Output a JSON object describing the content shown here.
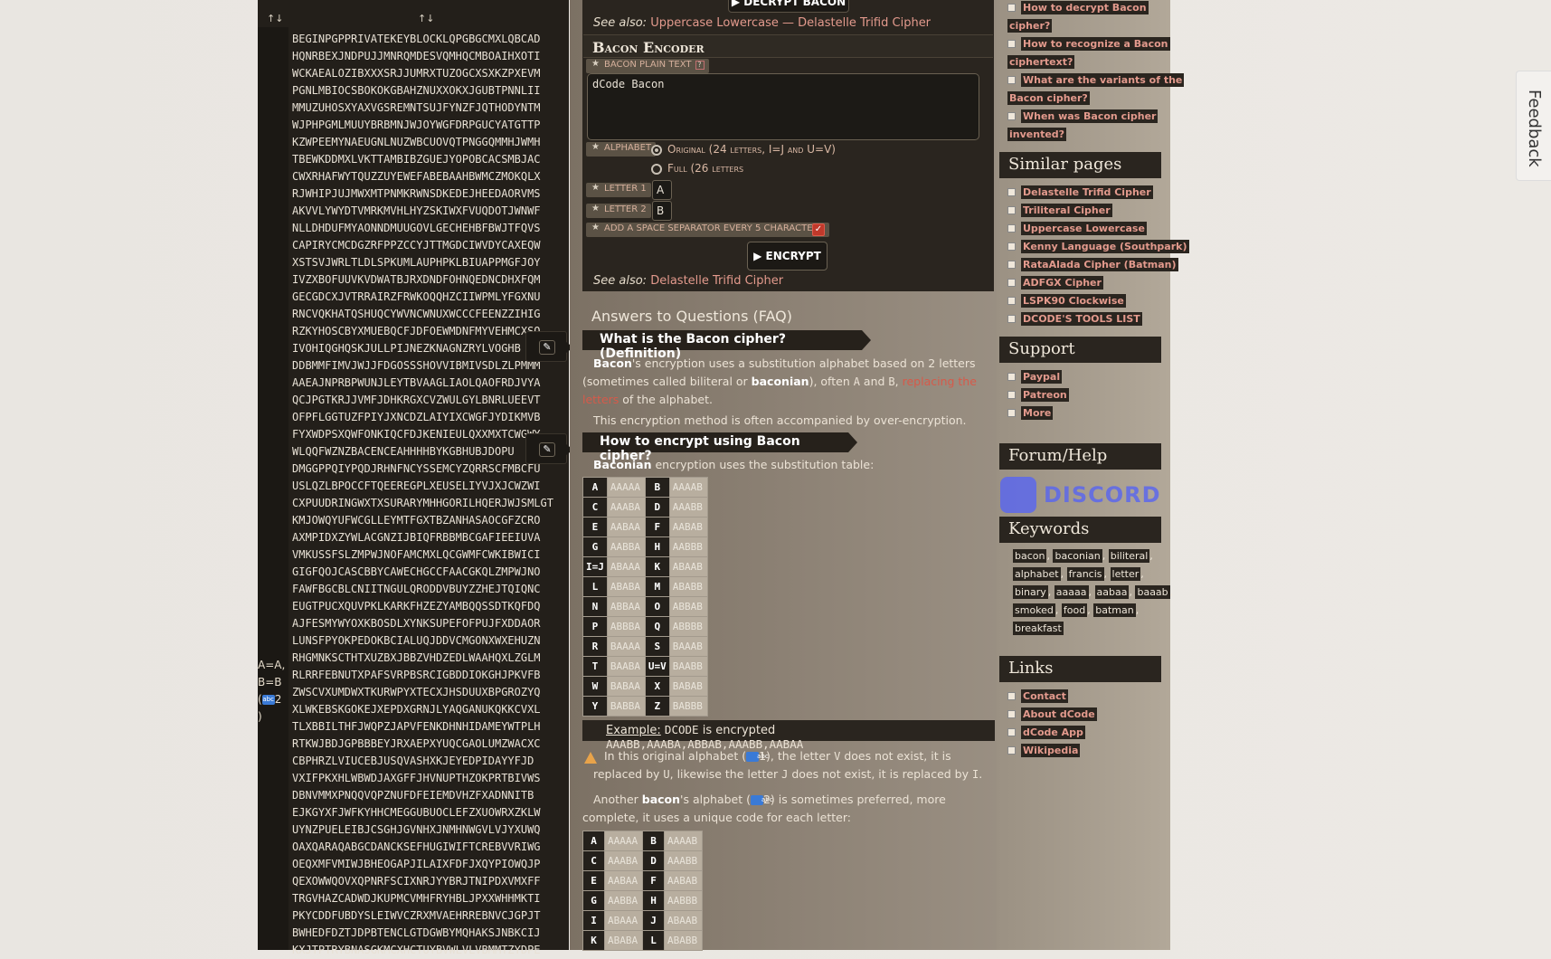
{
  "left_panel": {
    "sort_a": "↑↓",
    "sort_b": "↑↓",
    "note": [
      "A=A,",
      "B=B",
      "(",
      "2",
      ")"
    ],
    "lines": [
      "BEGINPGPPRIVATEKEYBLOCKLQPGBGCMXLQBCAD",
      "HQNRBEXJNDPUJJMNRQMDESVQMHQCMBOAIHXOTI",
      "WCKAEALOZIBXXXSRJJUMRXTUZOGCXSXKZPXEVM",
      "PGNLMBIOCSBOKOKGBAHZNUXXOKXJGUBTPNNLII",
      "MMUZUHOSXYAXVGSREMNTSUJFYNZFJQTHODYNTM",
      "WJPHPGMLMUUYBRBMNJWJOYWGFDRPGUCYATGTTP",
      "KZWPEEMYNAEUGNLNUZWBCUOVQTPNGGQMMHJWMH",
      "TBEWKDDMXLVKTTAMBIBZGUEJYOPOBCACSMBJAC",
      "CWXRHAFWYTQUZZUYEWEFABEBAAHBWMCZMOKQLX",
      "RJWHIPJUJMWXMTPNMKRWNSDKEDEJHEEDAORVMS",
      "AKVVLYWYDTVMRKMVHLHYZSKIWXFVUQDOTJWNWF",
      "NLLDHDUFMYAONNDMUUGOVLGECHEHBFBWJTFQVS",
      "CAPIRYCMCDGZRFPPZCCYJTTMGDCIWVDYCAXEQW",
      "XSTSVJWRLTLDLSPKUMLAUPHPKLBIUAPPMGFJOY",
      "IVZXBOFUUVKVDWATBJRXDNDFOHNQEDNCDHXFQM",
      "GECGDCXJVTRRAIRZFRWKOQQHZCIIWPMLYFGXNU",
      "RNCVQKHATQSHUQCYWVNCWNUXWCCCFEENZZIHIG",
      "RZKYHOSCBYXMUEBQCFJDFOEWMDNFMYVEHMCXSO",
      "IVOHIQGHQSKJULLPIJNEZKNAGNZRYLVOGHB",
      "DDBMMFIMVJWJJFDGOSSSHOVVIBMIVSDLZLPMMM",
      "AAEAJNPRBPWUNJLEYTBVAAGLIAOLQAOFRDJVYA",
      "QCJPGTKRJJVMFJDHKRGXCVZWULGYLBNRLUEEVT",
      "OFPFLGGTUZFPIYJXNCDZLAIYIXCWGFJYDIKMVB",
      "FYXWDPSXQWFONKIQCFDJKENIEULQXXMXTCWGWY",
      "WLQQFWZNZBACENCEAHHHHBYKGBHUBJDOPU",
      "DMGGPPQIYPQDJRHNFNCYSSEMCYZQRRSCFMBCFU",
      "USLQZLBPOCCFTQEEREGPLXEUSELIYVJXJCWZWI",
      "CXPUUDRINGWXTXSURARYMHHGORILHQERJWJSMLGT",
      "KMJOWQYUFWCGLLEYMTFGXTBZANHASAOCGFZCRO",
      "AXMPIDXZYWLACGNZIJBIQFRBBMBCGAFIEEIUVA",
      "VMKUSSFSLZMPWJNOFAMCMXLQCGWMFCWKIBWICI",
      "GIGFQOJCASCBBYCAWECHGCCFAACGKQLZMPWJNO",
      "FAWFBGCBLCNIITNGULQRODDVBUYZZHEJTQIQNC",
      "EUGTPUCXQUVPKLKARKFHZEZYAMBQQSSDTKQFDQ",
      "AJFESMYWYOXKBOSDLXYNKSUPEFOFPUJFXDDAOR",
      "LUNSFPYOKPEDOKBCIALUQJDDVCMGONXWXEHUZN",
      "RHGMNKSCTHTXUZBXJBBZVHDZEDLWAAHQXLZGLM",
      "RLRRFEBNUTXPAFSVRPBSRCIGBDDIOKGHJPKVFB",
      "ZWSCVXUMDWXTKURWPYXTECXJHSDUUXBPGROZYQ",
      "XLWKEBSKGOKEJXEPDXGRNJLYAQGANUKQKKCVXL",
      "TLXBBILTHFJWQPZJAPVFENKDHNHIDAMEYWTPLH",
      "RTKWJBDJGPBBBEYJRXAEPXYUQCGAOLUMZWACXC",
      "CBPHRZLVIUCEBJUSQVASHXKJEYEDPIDAYYFJD",
      "VXIFPKXHLWBWDJAXGFFJHVNUPTHZOKPRTBIVWS",
      "DBNVMMXPNQQVQPZNUFDFEIEMDVHZFXADNNITB",
      "EJKGYXFJWFKYHHCMEGGUBUOCLEFZXUOWRXZKLW",
      "UYNZPUELEIBJCSGHJGVNHXJNMHNWGVLVJYXUWQ",
      "OAXQARAQABGCDANCKSEFHUGIWIFTCREBVVRIWG",
      "OEQXMFVMIWJBHEOGAPJILAIXFDFJXQYPIOWQJP",
      "QEXOWWQOVXQPNRFSCIXNRJYYBRJTNIPDXVMXFF",
      "TRGVHAZCADWDJKUPMCVMHFRYHBLJPXXWHHMKTI",
      "PKYCDDFUBDYSLEIWVCZRXMVAEHRREBNVCJGPJT",
      "BWHEDFDZTJDPBTENCLGTDGWBYMQHAKSJNBKCIJ",
      "KXJTPTRYBNASGKMCXHCTUYBVWLVLVBMMTZYDPE"
    ]
  },
  "encoder": {
    "top_button": "▶ DECRYPT BACON",
    "see_also_label": "See also:",
    "see_also_top_1": "Uppercase Lowercase",
    "see_also_sep": "—",
    "see_also_top_2": "Delastelle Trifid Cipher",
    "title": "Bacon Encoder",
    "plain_text_label": "BACON PLAIN TEXT",
    "plain_text_value": "dCode Bacon",
    "alphabet_label": "ALPHABET",
    "alphabet_opt1": "Original (24 letters, I=J and U=V)",
    "alphabet_opt2": "Full (26 letters",
    "letter1_label": "LETTER 1",
    "letter1_value": "A",
    "letter2_label": "LETTER 2",
    "letter2_value": "B",
    "separator_label": "ADD A SPACE SEPARATOR EVERY 5 CHARACTERS",
    "encrypt_button": "▶ ENCRYPT",
    "see_also_bottom": "Delastelle Trifid Cipher"
  },
  "faq": {
    "title": "Answers to Questions (FAQ)",
    "q1": "What is the Bacon cipher? (Definition)",
    "q1_text_parts": [
      "Bacon",
      "'s encryption uses a substitution alphabet based on 2 letters (sometimes called biliteral or ",
      "baconian",
      "), often ",
      "A",
      " and ",
      "B",
      ", ",
      "replacing the letters",
      " of the alphabet."
    ],
    "q1_text2": "This encryption method is often accompanied by over-encryption.",
    "q2": "How to encrypt using Bacon cipher?",
    "q2_text_parts": [
      "Baconian",
      " encryption uses the substitution table:"
    ],
    "table1": [
      [
        "A",
        "AAAAA",
        "B",
        "AAAAB"
      ],
      [
        "C",
        "AAABA",
        "D",
        "AAABB"
      ],
      [
        "E",
        "AABAA",
        "F",
        "AABAB"
      ],
      [
        "G",
        "AABBA",
        "H",
        "AABBB"
      ],
      [
        "I=J",
        "ABAAA",
        "K",
        "ABAAB"
      ],
      [
        "L",
        "ABABA",
        "M",
        "ABABB"
      ],
      [
        "N",
        "ABBAA",
        "O",
        "ABBAB"
      ],
      [
        "P",
        "ABBBA",
        "Q",
        "ABBBB"
      ],
      [
        "R",
        "BAAAA",
        "S",
        "BAAAB"
      ],
      [
        "T",
        "BAABA",
        "U=V",
        "BAABB"
      ],
      [
        "W",
        "BABAA",
        "X",
        "BABAB"
      ],
      [
        "Y",
        "BABBA",
        "Z",
        "BABBB"
      ]
    ],
    "example_label": "Example:",
    "example_text1": "DCODE",
    "example_text2": "is encrypted",
    "example_text3": "AAABB,AAABA,ABBAB,AAABB,AABAA",
    "warn_text_parts": [
      "In this original alphabet (",
      "1), the letter ",
      "V",
      " does not exist, it is replaced by ",
      "U",
      ", likewise the letter ",
      "J",
      " does not exist, it is replaced by ",
      "I",
      "."
    ],
    "another_parts": [
      "Another ",
      "bacon",
      "'s alphabet (",
      "2) is sometimes preferred, more complete, it uses a unique code for each letter:"
    ],
    "table2": [
      [
        "A",
        "AAAAA",
        "B",
        "AAAAB"
      ],
      [
        "C",
        "AAABA",
        "D",
        "AAABB"
      ],
      [
        "E",
        "AABAA",
        "F",
        "AABAB"
      ],
      [
        "G",
        "AABBA",
        "H",
        "AABBB"
      ],
      [
        "I",
        "ABAAA",
        "J",
        "ABAAB"
      ],
      [
        "K",
        "ABABA",
        "L",
        "ABABB"
      ]
    ]
  },
  "sidebar": {
    "top_links": [
      "How to decrypt Bacon",
      "cipher?",
      "How to recognize a Bacon",
      "ciphertext?",
      "What are the variants of the",
      "Bacon cipher?",
      "When was Bacon cipher",
      "invented?"
    ],
    "similar_title": "Similar pages",
    "similar": [
      "Delastelle Trifid Cipher",
      "Triliteral Cipher",
      "Uppercase Lowercase",
      "Kenny Language (Southpark)",
      "RataAlada Cipher (Batman)",
      "ADFGX Cipher",
      "LSPK90 Clockwise",
      "DCODE'S TOOLS LIST"
    ],
    "support_title": "Support",
    "support": [
      "Paypal",
      "Patreon",
      "More"
    ],
    "forum_title": "Forum/Help",
    "discord": "DISCORD",
    "keywords_title": "Keywords",
    "keywords": [
      "bacon",
      "baconian",
      "biliteral",
      "alphabet",
      "francis",
      "letter",
      "binary",
      "aaaaa",
      "aabaa",
      "baaab",
      "smoked",
      "food",
      "batman",
      "breakfast"
    ],
    "links_title": "Links",
    "links": [
      "Contact",
      "About dCode",
      "dCode App",
      "Wikipedia"
    ]
  },
  "feedback": "Feedback",
  "colors": {
    "accent_link": "#e39a8d",
    "dark_panel": "#2a251f",
    "checkbox": "#c0392b"
  }
}
